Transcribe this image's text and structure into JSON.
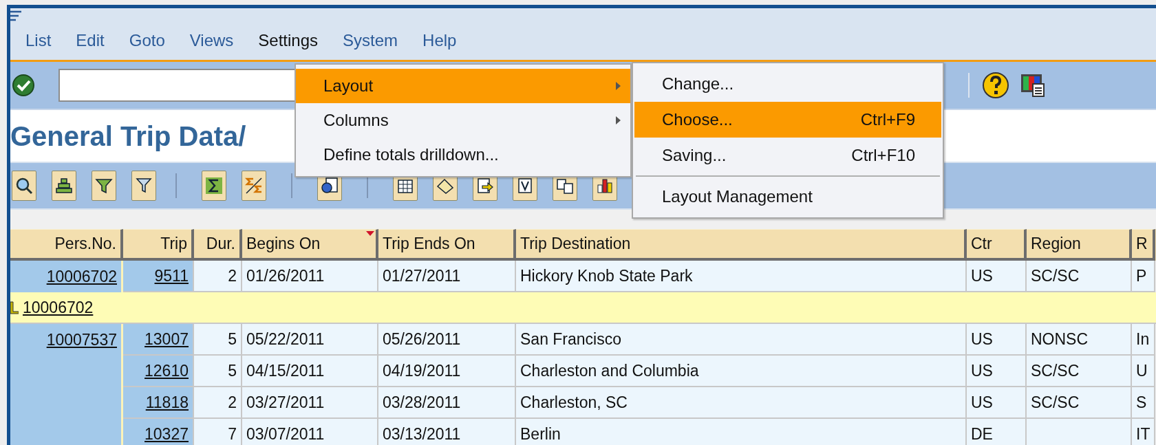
{
  "menu_bar": {
    "items": [
      {
        "label": "List",
        "selected": false
      },
      {
        "label": "Edit",
        "selected": false
      },
      {
        "label": "Goto",
        "selected": false
      },
      {
        "label": "Views",
        "selected": false
      },
      {
        "label": "Settings",
        "selected": true
      },
      {
        "label": "System",
        "selected": false
      },
      {
        "label": "Help",
        "selected": false
      }
    ]
  },
  "page_title": "General Trip Data/",
  "settings_menu": {
    "items": [
      {
        "label": "Layout",
        "has_submenu": true,
        "selected": true
      },
      {
        "label": "Columns",
        "has_submenu": true,
        "selected": false
      },
      {
        "label": "Define totals drilldown...",
        "has_submenu": false,
        "selected": false
      }
    ]
  },
  "layout_submenu": {
    "items": [
      {
        "kind": "item",
        "label": "Change...",
        "selected": false
      },
      {
        "kind": "item",
        "label": "Choose...",
        "shortcut": "Ctrl+F9",
        "selected": true
      },
      {
        "kind": "item",
        "label": "Saving...",
        "shortcut": "Ctrl+F10",
        "selected": false
      },
      {
        "kind": "separator"
      },
      {
        "kind": "item",
        "label": "Layout Management",
        "selected": false
      }
    ]
  },
  "table": {
    "columns": [
      {
        "label": "Pers.No.",
        "sorted": false
      },
      {
        "label": "Trip",
        "sorted": false
      },
      {
        "label": "Dur.",
        "sorted": false
      },
      {
        "label": "Begins On",
        "sorted": true
      },
      {
        "label": "Trip Ends On",
        "sorted": false
      },
      {
        "label": "Trip Destination",
        "sorted": false
      },
      {
        "label": "Ctr",
        "sorted": false
      },
      {
        "label": "Region",
        "sorted": false
      },
      {
        "label": "R",
        "sorted": false
      }
    ],
    "rows": [
      {
        "kind": "data",
        "cells": [
          "10006702",
          "9511",
          "2",
          "01/26/2011",
          "01/27/2011",
          "Hickory Knob State Park",
          "US",
          "SC/SC",
          "P"
        ]
      },
      {
        "kind": "subtotal",
        "cells": [
          "10006702"
        ]
      },
      {
        "kind": "data",
        "cells": [
          "10007537",
          "13007",
          "5",
          "05/22/2011",
          "05/26/2011",
          "San Francisco",
          "US",
          "NONSC",
          "In"
        ]
      },
      {
        "kind": "data",
        "cells": [
          "",
          "12610",
          "5",
          "04/15/2011",
          "04/19/2011",
          "Charleston and Columbia",
          "US",
          "SC/SC",
          "U"
        ]
      },
      {
        "kind": "data",
        "cells": [
          "",
          "11818",
          "2",
          "03/27/2011",
          "03/28/2011",
          "Charleston, SC",
          "US",
          "SC/SC",
          "S"
        ]
      },
      {
        "kind": "data",
        "cells": [
          "",
          "10327",
          "7",
          "03/07/2011",
          "03/13/2011",
          "Berlin",
          "DE",
          "",
          "IT"
        ]
      }
    ]
  }
}
